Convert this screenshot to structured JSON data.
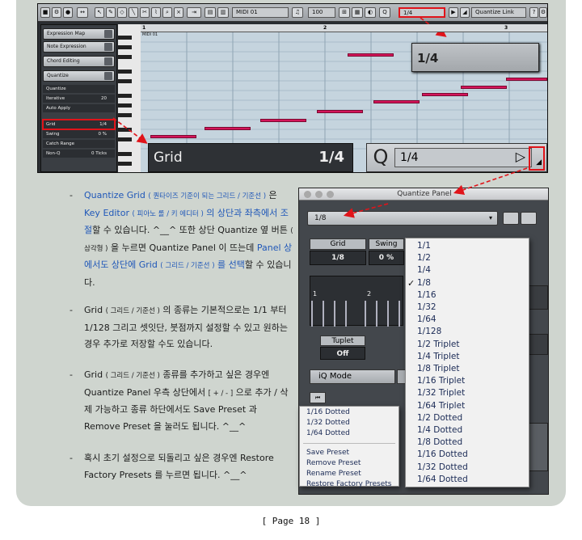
{
  "key_editor": {
    "toolbar": {
      "midi_part": "MIDI 01",
      "zoom": "100",
      "quantize_field": "1/4",
      "quantize_link": "Quantize Link"
    },
    "inspector": {
      "sections": [
        "Expression Map",
        "Note Expression",
        "Chord Editing",
        "Quantize"
      ],
      "rows": [
        {
          "label": "Quantize",
          "value": ""
        },
        {
          "label": "Iterative",
          "value": "20"
        },
        {
          "label": "Auto Apply",
          "value": ""
        },
        {
          "label": "Grid",
          "value": "1/4"
        },
        {
          "label": "Swing",
          "value": "0 %"
        },
        {
          "label": "Catch Range",
          "value": ""
        },
        {
          "label": "Non-Q",
          "value": "0 Ticks"
        }
      ]
    },
    "ruler_marks": [
      "1",
      "2",
      "3"
    ],
    "part_label": "MIDI 01",
    "pitch_labels": [
      "C4",
      "C3"
    ],
    "callouts": {
      "grid_label": "Grid",
      "grid_value": "1/4",
      "q_letter": "Q",
      "q_value": "1/4",
      "top_value": "1/4"
    }
  },
  "bullets": [
    {
      "parts": [
        {
          "t": "Quantize Grid ",
          "c": "blue"
        },
        {
          "t": "( 퀀타이즈 기준이 되는 그리드 / 기준선 )",
          "c": "blue small"
        },
        {
          "t": " 은 ",
          "c": ""
        },
        {
          "t": "Key Editor ",
          "c": "blue"
        },
        {
          "t": "( 피아노 롤 / 키 에디터 )",
          "c": "blue small"
        },
        {
          "t": " 의 상단과 좌측에서 조절",
          "c": "blue"
        },
        {
          "t": "할 수 있습니다. ^__^ 또한 상단 Quantize 옆 버튼 ",
          "c": ""
        },
        {
          "t": "( 삼각형 )",
          "c": "small"
        },
        {
          "t": " 을 누르면 Quantize Panel 이 뜨는데 ",
          "c": ""
        },
        {
          "t": "Panel 상에서도 상단에 Grid ",
          "c": "blue"
        },
        {
          "t": "( 그리드 / 기준선 )",
          "c": "blue small"
        },
        {
          "t": " 를 선택",
          "c": "blue"
        },
        {
          "t": "할 수 있습니다.",
          "c": ""
        }
      ]
    },
    {
      "parts": [
        {
          "t": "Grid ",
          "c": ""
        },
        {
          "t": "( 그리드 / 기준선 )",
          "c": "small"
        },
        {
          "t": " 의 종류는 기본적으로는 1/1 부터 1/128 그리고 셋잇단, 붓점까지 설정할 수 있고 원하는 경우 추가로 저장할 수도 있습니다.",
          "c": ""
        }
      ]
    },
    {
      "parts": [
        {
          "t": "Grid ",
          "c": ""
        },
        {
          "t": "( 그리드 / 기준선 )",
          "c": "small"
        },
        {
          "t": " 종류를 추가하고 싶은 경우엔 Quantize Panel 우측 상단에서 ",
          "c": ""
        },
        {
          "t": "[ + / - ]",
          "c": "small"
        },
        {
          "t": " 으로 추가 / 삭제 가능하고 종류 하단에서도 Save Preset 과 Remove Preset 을 눌러도 됩니다. ^__^",
          "c": ""
        }
      ]
    },
    {
      "parts": [
        {
          "t": "혹시 초기 설정으로 되돌리고 싶은 경우엔 Restore Factory Presets 를 누르면 됩니다. ^__^",
          "c": ""
        }
      ]
    }
  ],
  "quantize_panel": {
    "title": "Quantize Panel",
    "preset_value": "1/8",
    "grid_label": "Grid",
    "grid_value": "1/8",
    "swing_label": "Swing",
    "swing_value": "0 %",
    "gridview_marks": [
      "1",
      "2"
    ],
    "tuplet_label": "Tuplet",
    "tuplet_value": "Off",
    "iq_mode": "iQ Mode",
    "grid_menu": [
      "1/1",
      "1/2",
      "1/4",
      "1/8",
      "1/16",
      "1/32",
      "1/64",
      "1/128",
      "1/2  Triplet",
      "1/4  Triplet",
      "1/8  Triplet",
      "1/16  Triplet",
      "1/32  Triplet",
      "1/64  Triplet",
      "1/2  Dotted",
      "1/4  Dotted",
      "1/8  Dotted",
      "1/16  Dotted",
      "1/32  Dotted",
      "1/64  Dotted"
    ],
    "grid_menu_checked": "1/8",
    "preset_menu_values": [
      "1/16  Dotted",
      "1/32  Dotted",
      "1/64  Dotted"
    ],
    "preset_menu_actions": [
      "Save Preset",
      "Remove Preset",
      "Rename Preset",
      "Restore Factory Presets"
    ]
  },
  "footer": "[ Page 18 ]"
}
